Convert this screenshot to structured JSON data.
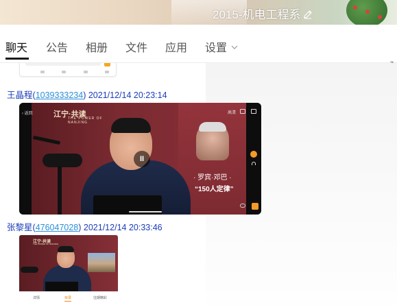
{
  "header": {
    "group_name": "2015-机电工程系"
  },
  "tabs": [
    {
      "label": "聊天"
    },
    {
      "label": "公告"
    },
    {
      "label": "相册"
    },
    {
      "label": "文件"
    },
    {
      "label": "应用"
    },
    {
      "label": "设置"
    }
  ],
  "messages": [
    {
      "sender": "王晶程",
      "qq": "1039333234",
      "time": "2021/12/14 20:23:14",
      "video": {
        "logo": "江宁·共读",
        "logo_sub": "THE POWER OF NANJING",
        "back_label": "返回",
        "hd_label": "高清",
        "caption_name": "· 罗宾·邓巴 ·",
        "caption_title": "“150人定律”",
        "paused_glyph": "II"
      }
    },
    {
      "sender": "张黎星",
      "qq": "476047028",
      "time": "2021/12/14 20:33:46",
      "video": {
        "logo": "江宁·共读",
        "logo_sub": "THE POWER OF NANJING",
        "tabs": [
          "详情",
          "目录",
          "往期精彩"
        ]
      }
    }
  ],
  "colors": {
    "sender_name": "#1a3cb8",
    "qq_link": "#2a8fd8",
    "accent_orange": "#f39a29"
  }
}
